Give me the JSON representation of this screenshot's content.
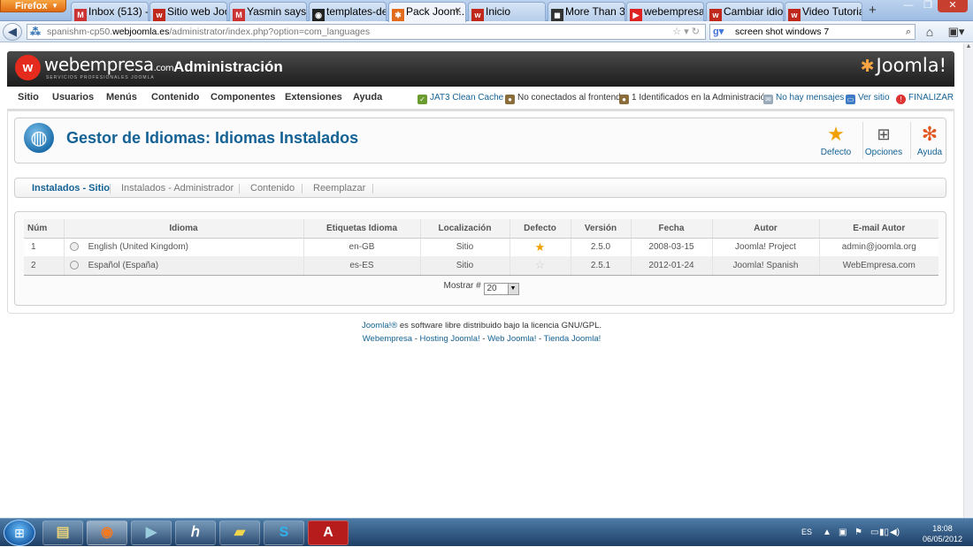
{
  "browser": {
    "app_button": "Firefox",
    "tabs": [
      {
        "label": "Inbox (513) - ...",
        "icon": "gmail-icon"
      },
      {
        "label": "Sitio web Joo...",
        "icon": "webempresa-icon"
      },
      {
        "label": "Yasmin says...",
        "icon": "gmail-icon"
      },
      {
        "label": "templates-de...",
        "icon": "github-icon"
      },
      {
        "label": "Pack Joom...",
        "icon": "joomla-icon",
        "active": true
      },
      {
        "label": "Inicio",
        "icon": "webempresa-icon"
      },
      {
        "label": "More Than 31...",
        "icon": "generic-icon"
      },
      {
        "label": "webempresa ...",
        "icon": "youtube-icon"
      },
      {
        "label": "Cambiar idio...",
        "icon": "webempresa-icon"
      },
      {
        "label": "Video Tutorial...",
        "icon": "webempresa-icon"
      }
    ],
    "url_prefix": "spanishm-cp50.",
    "url_domain": "webjoomla.es",
    "url_suffix": "/administrator/index.php?option=com_languages",
    "search_value": "screen shot windows 7"
  },
  "joomla": {
    "brand": "webempresa",
    "brand_domain": ".com",
    "brand_sub": "SERVICIOS PROFESIONALES JOOMLA",
    "header_title": "Administración",
    "joomla_logo": "Joomla!",
    "menu": [
      "Sitio",
      "Usuarios",
      "Menús",
      "Contenido",
      "Componentes",
      "Extensiones",
      "Ayuda"
    ],
    "status": {
      "cache": "JAT3 Clean Cache",
      "frontend": "No conectados al frontend",
      "admins": "1 Identificados en la Administración",
      "messages": "No hay mensajes",
      "view_site": "Ver sitio",
      "logout": "FINALIZAR"
    },
    "page_title": "Gestor de Idiomas: Idiomas Instalados",
    "toolbar": {
      "default": "Defecto",
      "options": "Opciones",
      "help": "Ayuda"
    },
    "subnav": [
      "Instalados - Sitio",
      "Instalados - Administrador",
      "Contenido",
      "Reemplazar"
    ],
    "table": {
      "headers": [
        "Núm",
        "Idioma",
        "Etiquetas Idioma",
        "Localización",
        "Defecto",
        "Versión",
        "Fecha",
        "Autor",
        "E-mail Autor"
      ],
      "rows": [
        {
          "num": "1",
          "language": "English (United Kingdom)",
          "tag": "en-GB",
          "location": "Sitio",
          "default": true,
          "version": "2.5.0",
          "date": "2008-03-15",
          "author": "Joomla! Project",
          "email": "admin@joomla.org"
        },
        {
          "num": "2",
          "language": "Español (España)",
          "tag": "es-ES",
          "location": "Sitio",
          "default": false,
          "version": "2.5.1",
          "date": "2012-01-24",
          "author": "Joomla! Spanish",
          "email": "WebEmpresa.com"
        }
      ]
    },
    "pager_label": "Mostrar #",
    "pager_value": "20",
    "footer": {
      "joomla_link": "Joomla!®",
      "license_text": " es software libre distribuido bajo la licencia GNU/GPL.",
      "links": [
        "Webempresa",
        "Hosting Joomla!",
        "Web Joomla!",
        "Tienda Joomla!"
      ]
    }
  },
  "taskbar": {
    "language": "ES",
    "time": "18:08",
    "date": "06/05/2012"
  }
}
